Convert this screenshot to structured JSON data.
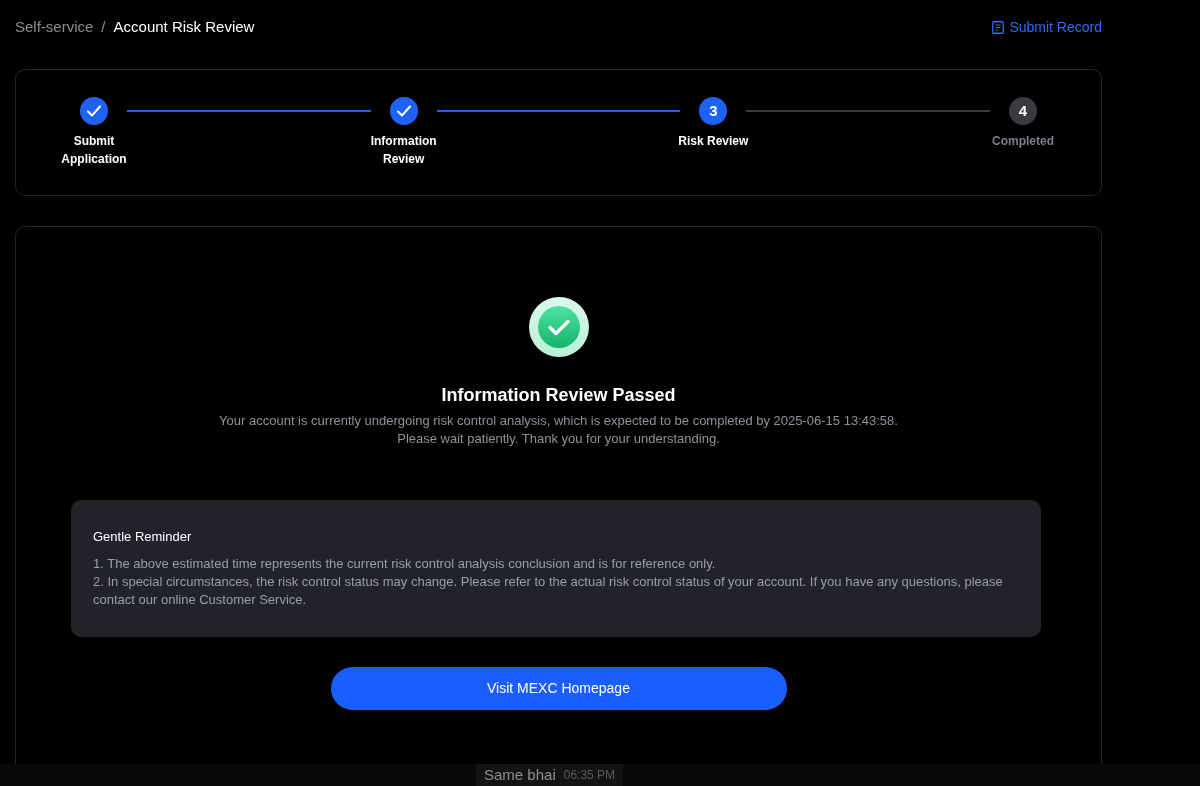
{
  "breadcrumb": {
    "items": [
      {
        "label": "Self-service",
        "selected": false
      },
      {
        "label": "Account Risk Review",
        "selected": true
      }
    ],
    "separator": "/"
  },
  "submit_record": {
    "label": "Submit Record"
  },
  "steps": [
    {
      "kind": "done",
      "label": "Submit Application"
    },
    {
      "kind": "done",
      "label": "Information Review"
    },
    {
      "kind": "active",
      "number": "3",
      "label": "Risk Review"
    },
    {
      "kind": "pending",
      "number": "4",
      "label": "Completed"
    }
  ],
  "result": {
    "title": "Information Review Passed",
    "description": "Your account is currently undergoing risk control analysis, which is expected to be completed by 2025-06-15 13:43:58.\nPlease wait patiently. Thank you for your understanding."
  },
  "reminder": {
    "title": "Gentle Reminder",
    "items": [
      "1. The above estimated time represents the current risk control analysis conclusion and is for reference only.",
      "2. In special circumstances, the risk control status may change. Please refer to the actual risk control status of your account. If you have any questions, please contact our online Customer Service."
    ]
  },
  "primary_button": {
    "label": "Visit MEXC Homepage"
  },
  "chat_overlay": {
    "message": "Same bhai",
    "time": "06:35 PM"
  }
}
